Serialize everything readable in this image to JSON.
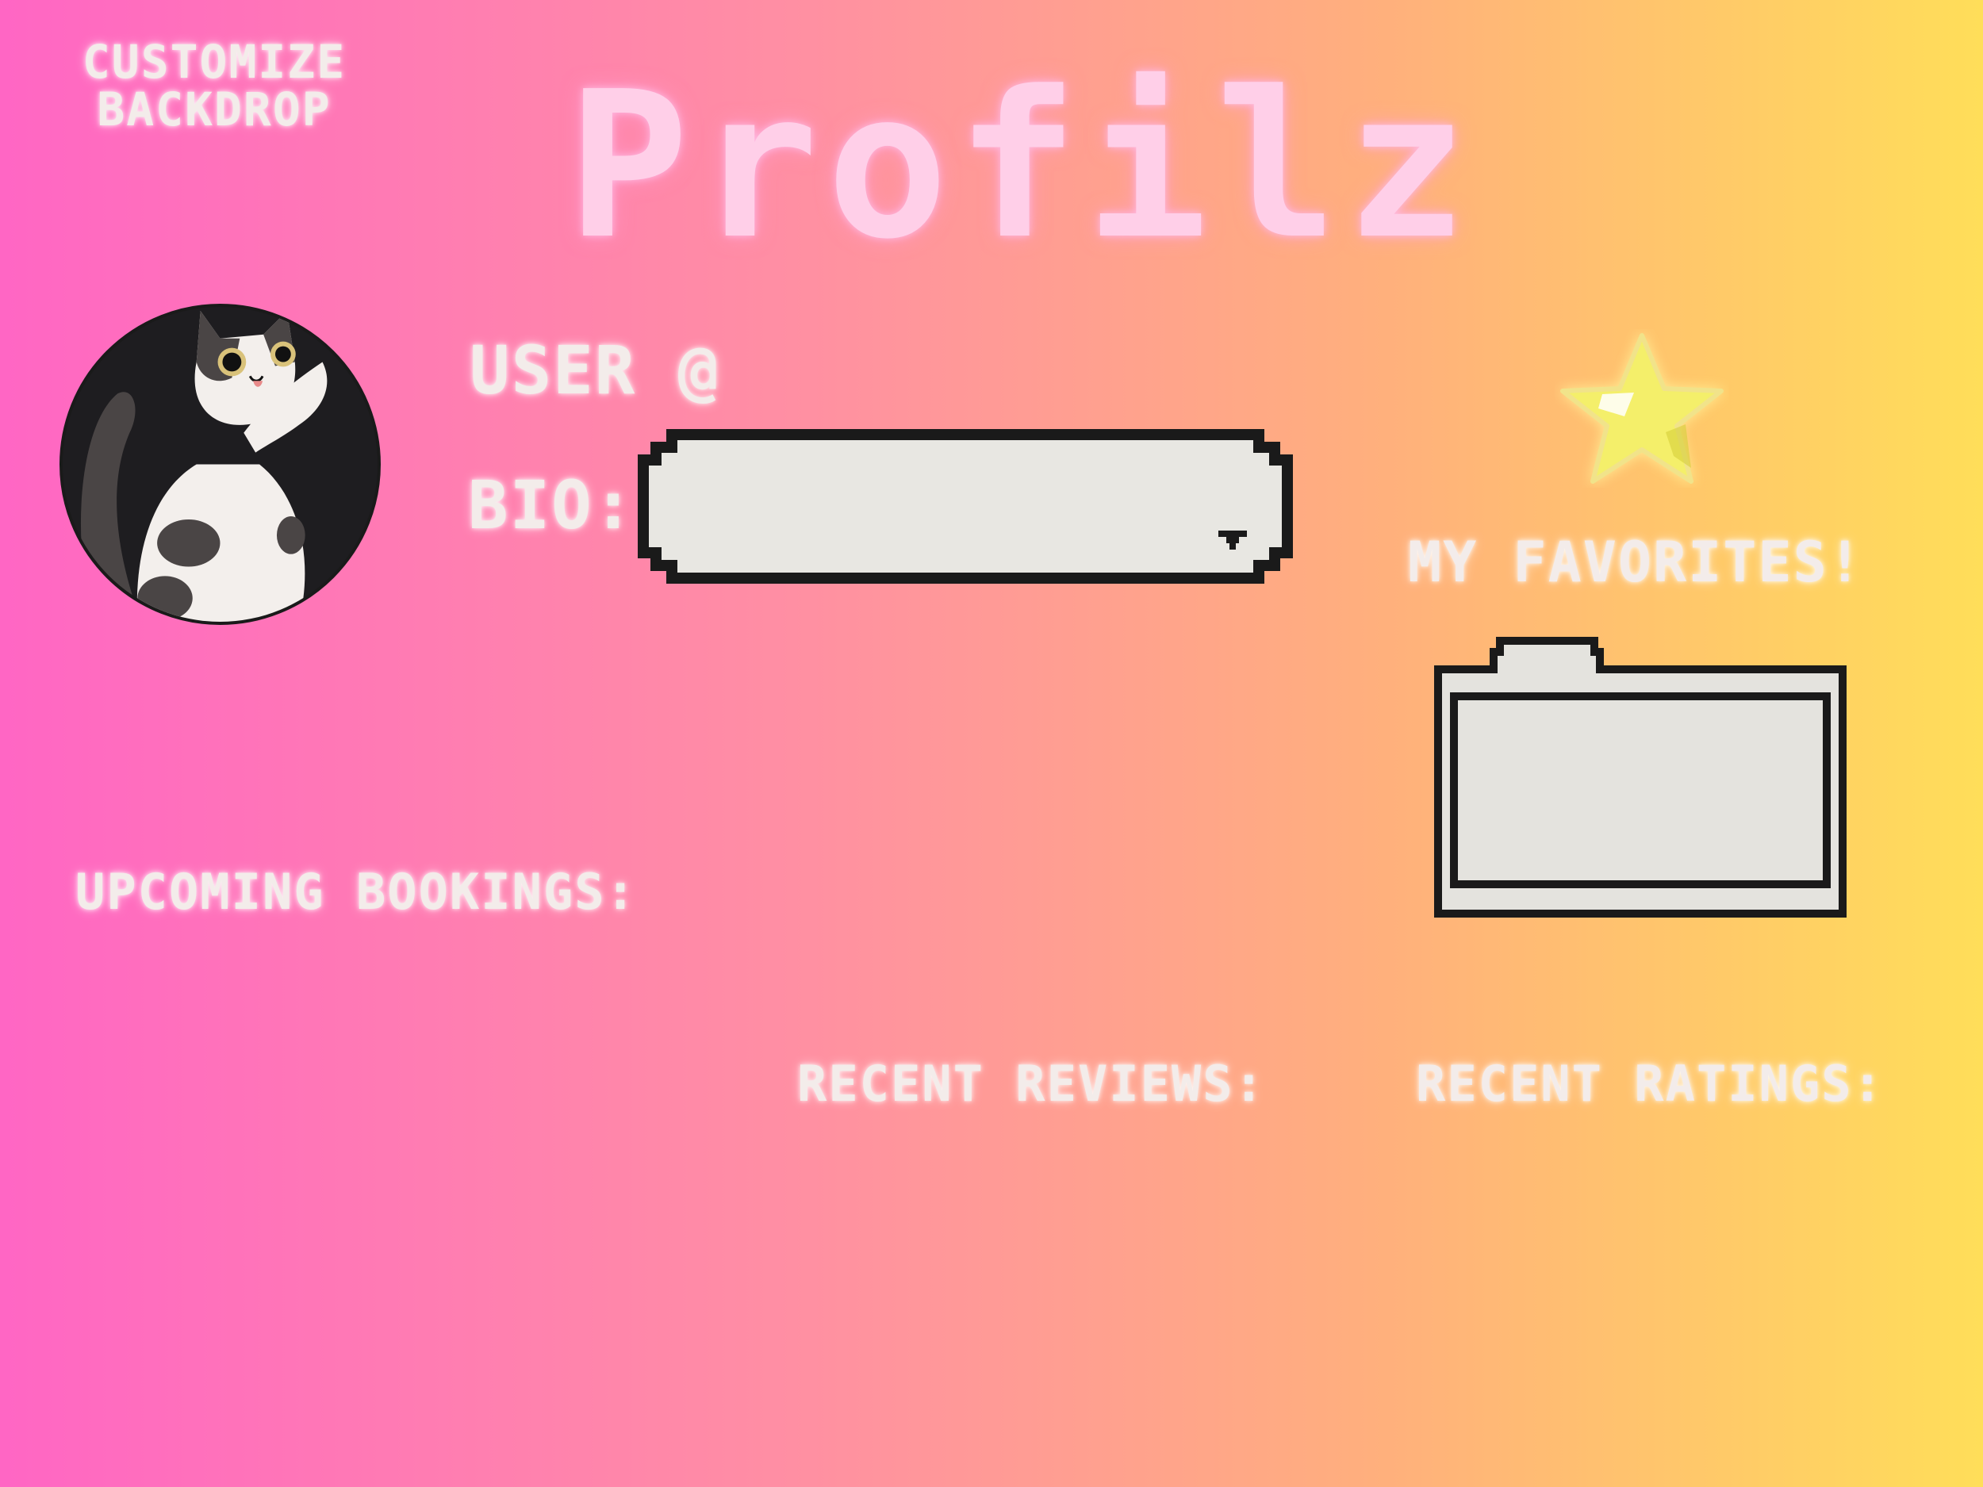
{
  "header": {
    "customize_backdrop": "CUSTOMIZE BACKDROP",
    "title": "Profilz"
  },
  "profile": {
    "avatar": "cat-avatar",
    "user_label": "USER @",
    "bio_label": "BIO:",
    "bio_value": "",
    "bio_dropdown_icon": "caret-down-icon"
  },
  "favorites": {
    "icon": "star-icon",
    "label": "MY FAVORITES!",
    "folder_icon": "folder-icon"
  },
  "sections": {
    "upcoming_bookings": "UPCOMING BOOKINGS:",
    "recent_reviews": "RECENT REVIEWS:",
    "recent_ratings": "RECENT RATINGS:"
  },
  "colors": {
    "gradient_left": "#ff66c4",
    "gradient_right": "#ffde59",
    "label_text": "#f3ecea",
    "title_text": "#ffcfe8",
    "field_fill": "#e8e7e2",
    "field_border": "#1a1a1a",
    "star_fill": "#f4ef6a"
  }
}
